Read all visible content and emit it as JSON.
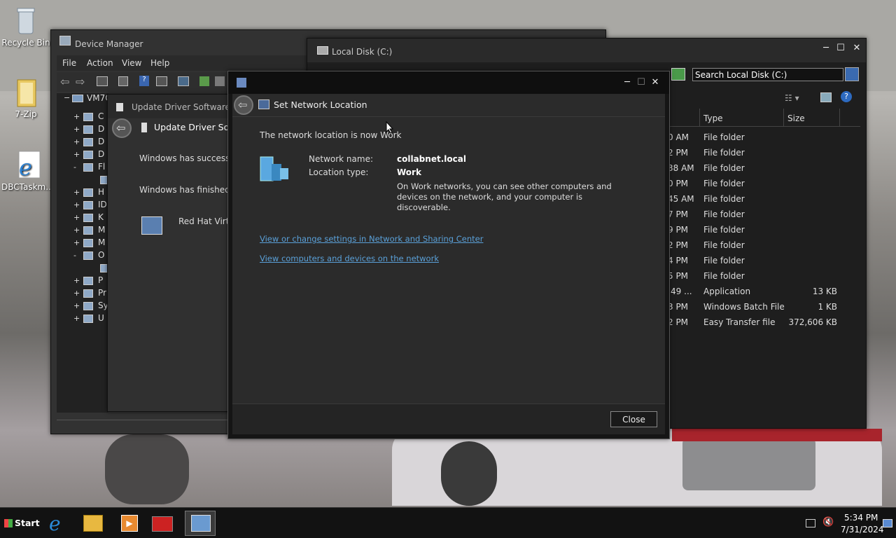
{
  "desktop": {
    "icons": [
      {
        "label": "Recycle Bin"
      },
      {
        "label": "7-Zip"
      },
      {
        "label": "DBCTaskm..."
      }
    ]
  },
  "device_manager": {
    "title": "Device Manager",
    "menu": [
      "File",
      "Action",
      "View",
      "Help"
    ],
    "tree_root": "VM7C",
    "tree_items": [
      {
        "pm": "+",
        "t": "C"
      },
      {
        "pm": "+",
        "t": "D"
      },
      {
        "pm": "+",
        "t": "D"
      },
      {
        "pm": "+",
        "t": "D"
      },
      {
        "pm": "-",
        "t": "Fl"
      },
      {
        "pm": "",
        "t": ""
      },
      {
        "pm": "+",
        "t": "H"
      },
      {
        "pm": "+",
        "t": "ID"
      },
      {
        "pm": "+",
        "t": "K"
      },
      {
        "pm": "+",
        "t": "M"
      },
      {
        "pm": "+",
        "t": "M"
      },
      {
        "pm": "-",
        "t": "O"
      },
      {
        "pm": "",
        "t": ""
      },
      {
        "pm": "+",
        "t": "P"
      },
      {
        "pm": "+",
        "t": "Pr"
      },
      {
        "pm": "+",
        "t": "Sy"
      },
      {
        "pm": "+",
        "t": "U"
      }
    ]
  },
  "update_driver": {
    "tab_title": "Update Driver Software - F",
    "header": "Update Driver Softw",
    "line1": "Windows has successful",
    "line2": "Windows has finished ir",
    "device": "Red Hat VirtIO"
  },
  "explorer": {
    "title": "Local Disk (C:)",
    "search_value": "Search Local Disk (C:)",
    "columns": [
      "Type",
      "Size"
    ],
    "rows": [
      {
        "d": "0 AM",
        "type": "File folder",
        "size": ""
      },
      {
        "d": "2 PM",
        "type": "File folder",
        "size": ""
      },
      {
        "d": "38 AM",
        "type": "File folder",
        "size": ""
      },
      {
        "d": "0 PM",
        "type": "File folder",
        "size": ""
      },
      {
        "d": "45 AM",
        "type": "File folder",
        "size": ""
      },
      {
        "d": "7 PM",
        "type": "File folder",
        "size": ""
      },
      {
        "d": "9 PM",
        "type": "File folder",
        "size": ""
      },
      {
        "d": "2 PM",
        "type": "File folder",
        "size": ""
      },
      {
        "d": "4 PM",
        "type": "File folder",
        "size": ""
      },
      {
        "d": "5 PM",
        "type": "File folder",
        "size": ""
      },
      {
        "d": ":49 ...",
        "type": "Application",
        "size": "13 KB"
      },
      {
        "d": "3 PM",
        "type": "Windows Batch File",
        "size": "1 KB"
      },
      {
        "d": "2 PM",
        "type": "Easy Transfer file",
        "size": "372,606 KB"
      }
    ]
  },
  "dialog": {
    "header": "Set Network Location",
    "status": "The network location is now Work",
    "name_label": "Network name:",
    "name_value": "collabnet.local",
    "type_label": "Location type:",
    "type_value": "Work",
    "description": [
      "On Work networks, you can see other computers and",
      "devices on the network, and your computer is",
      "discoverable."
    ],
    "link1": "View or change settings in Network and Sharing Center",
    "link2": "View computers and devices on the network",
    "close_label": "Close"
  },
  "taskbar": {
    "start_label": "Start",
    "time": "5:34 PM",
    "date": "7/31/2024"
  },
  "colors": {
    "window_bg": "#2a2a2a",
    "link": "#5aa0d8",
    "taskbar": "#121212"
  }
}
